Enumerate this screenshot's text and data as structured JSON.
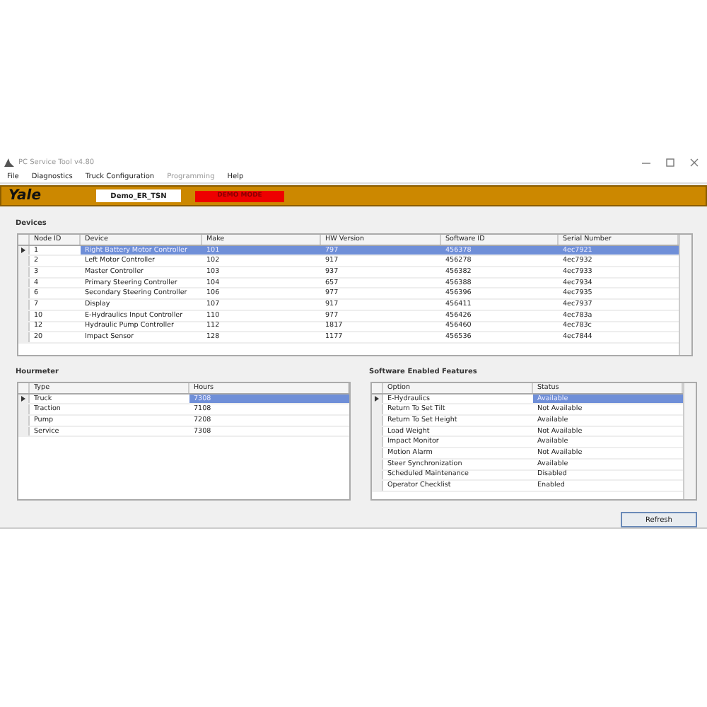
{
  "window": {
    "title": "PC Service Tool v4.80"
  },
  "menu": [
    {
      "label": "File",
      "disabled": false
    },
    {
      "label": "Diagnostics",
      "disabled": false
    },
    {
      "label": "Truck Configuration",
      "disabled": false
    },
    {
      "label": "Programming",
      "disabled": true
    },
    {
      "label": "Help",
      "disabled": false
    }
  ],
  "header": {
    "logo": "Yale",
    "truck_name": "Demo_ER_TSN",
    "mode": "DEMO MODE"
  },
  "devices": {
    "title": "Devices",
    "columns": [
      "Node ID",
      "Device",
      "Make",
      "HW Version",
      "Software ID",
      "Serial Number"
    ],
    "rows": [
      {
        "selected": true,
        "cells": [
          "1",
          "Right Battery Motor Controller",
          "101",
          "797",
          "456378",
          "4ec7921"
        ]
      },
      {
        "selected": false,
        "cells": [
          "2",
          "Left Motor Controller",
          "102",
          "917",
          "456278",
          "4ec7932"
        ]
      },
      {
        "selected": false,
        "cells": [
          "3",
          "Master Controller",
          "103",
          "937",
          "456382",
          "4ec7933"
        ]
      },
      {
        "selected": false,
        "cells": [
          "4",
          "Primary Steering Controller",
          "104",
          "657",
          "456388",
          "4ec7934"
        ]
      },
      {
        "selected": false,
        "cells": [
          "6",
          "Secondary Steering Controller",
          "106",
          "977",
          "456396",
          "4ec7935"
        ]
      },
      {
        "selected": false,
        "cells": [
          "7",
          "Display",
          "107",
          "917",
          "456411",
          "4ec7937"
        ]
      },
      {
        "selected": false,
        "cells": [
          "10",
          "E-Hydraulics Input Controller",
          "110",
          "977",
          "456426",
          "4ec783a"
        ]
      },
      {
        "selected": false,
        "cells": [
          "12",
          "Hydraulic Pump Controller",
          "112",
          "1817",
          "456460",
          "4ec783c"
        ]
      },
      {
        "selected": false,
        "cells": [
          "20",
          "Impact Sensor",
          "128",
          "1177",
          "456536",
          "4ec7844"
        ]
      }
    ]
  },
  "hourmeter": {
    "title": "Hourmeter",
    "columns": [
      "Type",
      "Hours"
    ],
    "rows": [
      {
        "selected": true,
        "cells": [
          "Truck",
          "7308"
        ]
      },
      {
        "selected": false,
        "cells": [
          "Traction",
          "7108"
        ]
      },
      {
        "selected": false,
        "cells": [
          "Pump",
          "7208"
        ]
      },
      {
        "selected": false,
        "cells": [
          "Service",
          "7308"
        ]
      }
    ]
  },
  "features": {
    "title": "Software Enabled Features",
    "columns": [
      "Option",
      "Status"
    ],
    "rows": [
      {
        "selected": true,
        "cells": [
          "E-Hydraulics",
          "Available"
        ]
      },
      {
        "selected": false,
        "cells": [
          "Return To Set Tilt",
          "Not Available"
        ]
      },
      {
        "selected": false,
        "cells": [
          "Return To Set Height",
          "Available"
        ]
      },
      {
        "selected": false,
        "cells": [
          "Load Weight",
          "Not Available"
        ]
      },
      {
        "selected": false,
        "cells": [
          "Impact Monitor",
          "Available"
        ]
      },
      {
        "selected": false,
        "cells": [
          "Motion Alarm",
          "Not Available"
        ]
      },
      {
        "selected": false,
        "cells": [
          "Steer Synchronization",
          "Available"
        ]
      },
      {
        "selected": false,
        "cells": [
          "Scheduled Maintenance",
          "Disabled"
        ]
      },
      {
        "selected": false,
        "cells": [
          "Operator Checklist",
          "Enabled"
        ]
      }
    ]
  },
  "refresh_button": "Refresh"
}
